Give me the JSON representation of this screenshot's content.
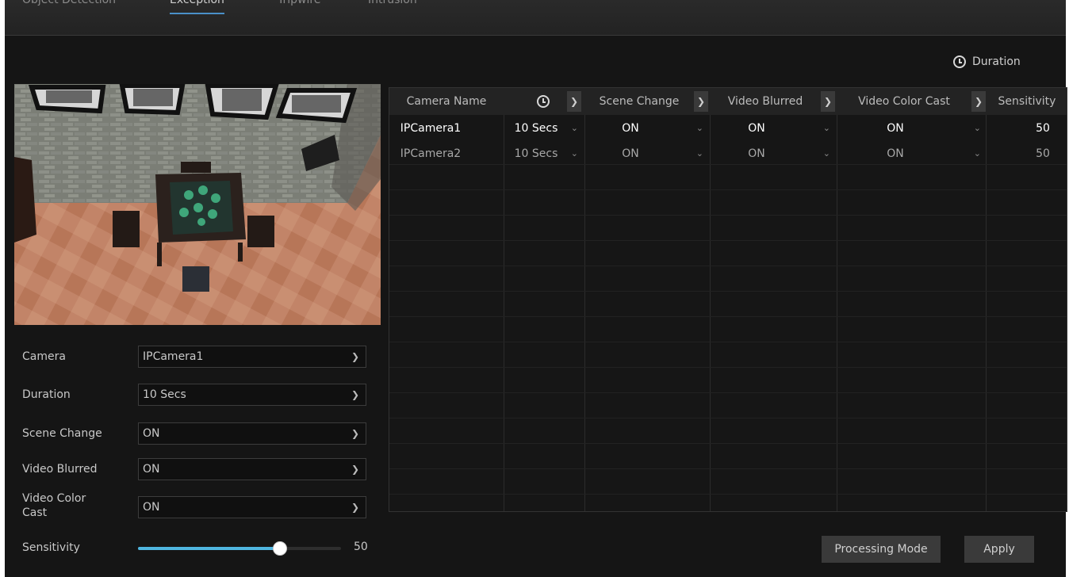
{
  "tabs": [
    "Object Detection",
    "Exception",
    "Tripwire",
    "Intrusion"
  ],
  "legend": {
    "icon": "clock-icon",
    "label": "Duration"
  },
  "form": {
    "camera_label": "Camera",
    "camera_value": "IPCamera1",
    "duration_label": "Duration",
    "duration_value": "10 Secs",
    "scene_change_label": "Scene Change",
    "scene_change_value": "ON",
    "video_blurred_label": "Video Blurred",
    "video_blurred_value": "ON",
    "video_color_cast_label": "Video Color Cast",
    "video_color_cast_value": "ON",
    "sensitivity_label": "Sensitivity",
    "sensitivity_value": "50",
    "sensitivity_max": 100
  },
  "table": {
    "headers": {
      "camera_name": "Camera Name",
      "duration_icon": "clock-icon",
      "scene_change": "Scene Change",
      "video_blurred": "Video Blurred",
      "video_color_cast": "Video Color Cast",
      "sensitivity": "Sensitivity"
    },
    "rows": [
      {
        "camera": "IPCamera1",
        "duration": "10 Secs",
        "scene_change": "ON",
        "video_blurred": "ON",
        "video_color_cast": "ON",
        "sensitivity": "50"
      },
      {
        "camera": "IPCamera2",
        "duration": "10 Secs",
        "scene_change": "ON",
        "video_blurred": "ON",
        "video_color_cast": "ON",
        "sensitivity": "50"
      }
    ]
  },
  "buttons": {
    "processing_mode": "Processing Mode",
    "apply": "Apply"
  },
  "colors": {
    "accent": "#4fb6e0",
    "background": "#151515",
    "panel": "#232323"
  }
}
